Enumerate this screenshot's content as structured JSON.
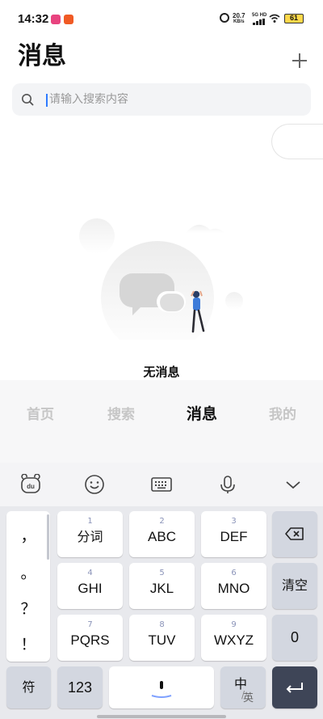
{
  "status_bar": {
    "time": "14:32",
    "net_speed_value": "20.7",
    "net_speed_unit": "KB/s",
    "network": "5G HD",
    "battery": "61"
  },
  "header": {
    "title": "消息",
    "add_icon": "plus-icon"
  },
  "search": {
    "placeholder": "请输入搜索内容",
    "icon": "search-icon"
  },
  "empty_state": {
    "text": "无消息",
    "illustration": "empty-messages-illustration"
  },
  "bottom_nav": {
    "items": [
      {
        "label": "首页",
        "active": false
      },
      {
        "label": "搜索",
        "active": false
      },
      {
        "label": "消息",
        "active": true
      },
      {
        "label": "我的",
        "active": false
      }
    ]
  },
  "keyboard": {
    "toolbar": [
      "baidu-logo-icon",
      "emoji-icon",
      "keyboard-icon",
      "microphone-icon",
      "chevron-down-icon"
    ],
    "punctuation": [
      "，",
      "。",
      "？",
      "！"
    ],
    "keys": [
      {
        "num": "1",
        "label": "分词"
      },
      {
        "num": "2",
        "label": "ABC"
      },
      {
        "num": "3",
        "label": "DEF"
      },
      {
        "num": "4",
        "label": "GHI"
      },
      {
        "num": "5",
        "label": "JKL"
      },
      {
        "num": "6",
        "label": "MNO"
      },
      {
        "num": "7",
        "label": "PQRS"
      },
      {
        "num": "8",
        "label": "TUV"
      },
      {
        "num": "9",
        "label": "WXYZ"
      }
    ],
    "clear_label": "清空",
    "zero_label": "0",
    "symbol_label": "符",
    "numeric_label": "123",
    "lang_main": "中",
    "lang_alt": "英",
    "backspace_icon": "backspace-icon",
    "enter_icon": "enter-icon",
    "space_icon": "microphone-icon"
  },
  "colors": {
    "accent_caret": "#2f7bff",
    "enter_key": "#3e4557",
    "nav_inactive": "#c6c6c6",
    "illustration_figure": "#3d7bd9"
  }
}
